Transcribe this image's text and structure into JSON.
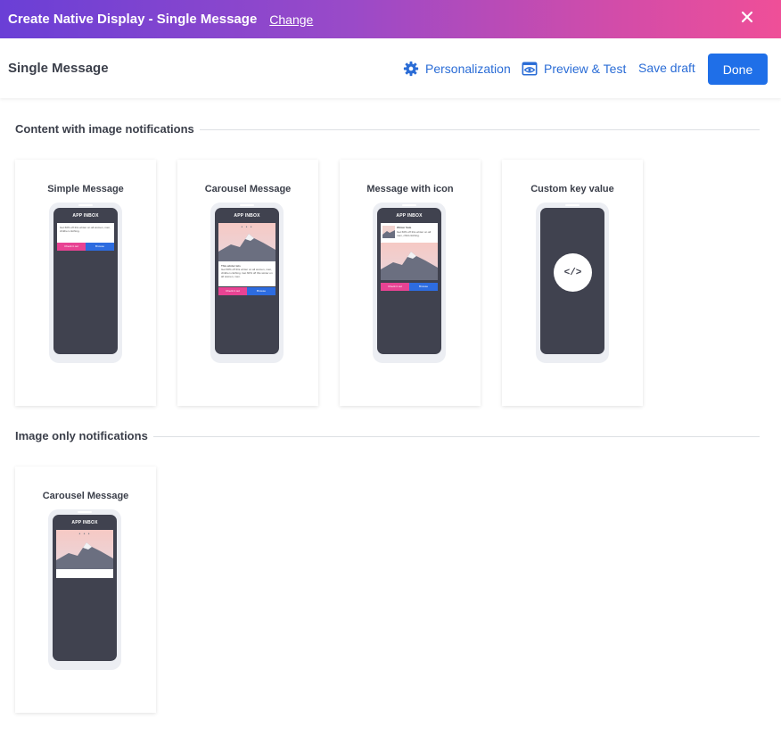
{
  "window": {
    "title": "Create Native Display - Single Message",
    "change_label": "Change"
  },
  "header": {
    "page_title": "Single Message",
    "personalization_label": "Personalization",
    "preview_label": "Preview & Test",
    "save_draft_label": "Save draft",
    "done_label": "Done"
  },
  "sections": [
    {
      "title": "Content with image notifications",
      "cards": [
        {
          "title": "Simple Message"
        },
        {
          "title": "Carousel Message"
        },
        {
          "title": "Message with icon"
        },
        {
          "title": "Custom key value"
        }
      ]
    },
    {
      "title": "Image only notifications",
      "cards": [
        {
          "title": "Carousel Message"
        }
      ]
    }
  ],
  "phone": {
    "inbox_label": "APP INBOX",
    "simple_text": "Get 60% off this winter on all women, men, children clothing.",
    "btn_primary": "Check it out",
    "btn_secondary": "Browse",
    "carousel_title": "This winter lets",
    "carousel_text": "Get 60% off this winter on all women, men, children clothing. Get 60% off this winter on all women, men.",
    "icon_title": "Winter Sale",
    "icon_text": "Get 60% off this winter on all men, child clothing.",
    "code_symbol": "</>"
  },
  "colors": {
    "brand_blue": "#1f6fe8",
    "link_blue": "#2a6cd6",
    "screen_dark": "#40424f",
    "pink": "#e84393"
  },
  "icons": {
    "close": "close-icon",
    "personalization": "gear-icon",
    "preview": "eye-icon",
    "code": "code-icon"
  }
}
